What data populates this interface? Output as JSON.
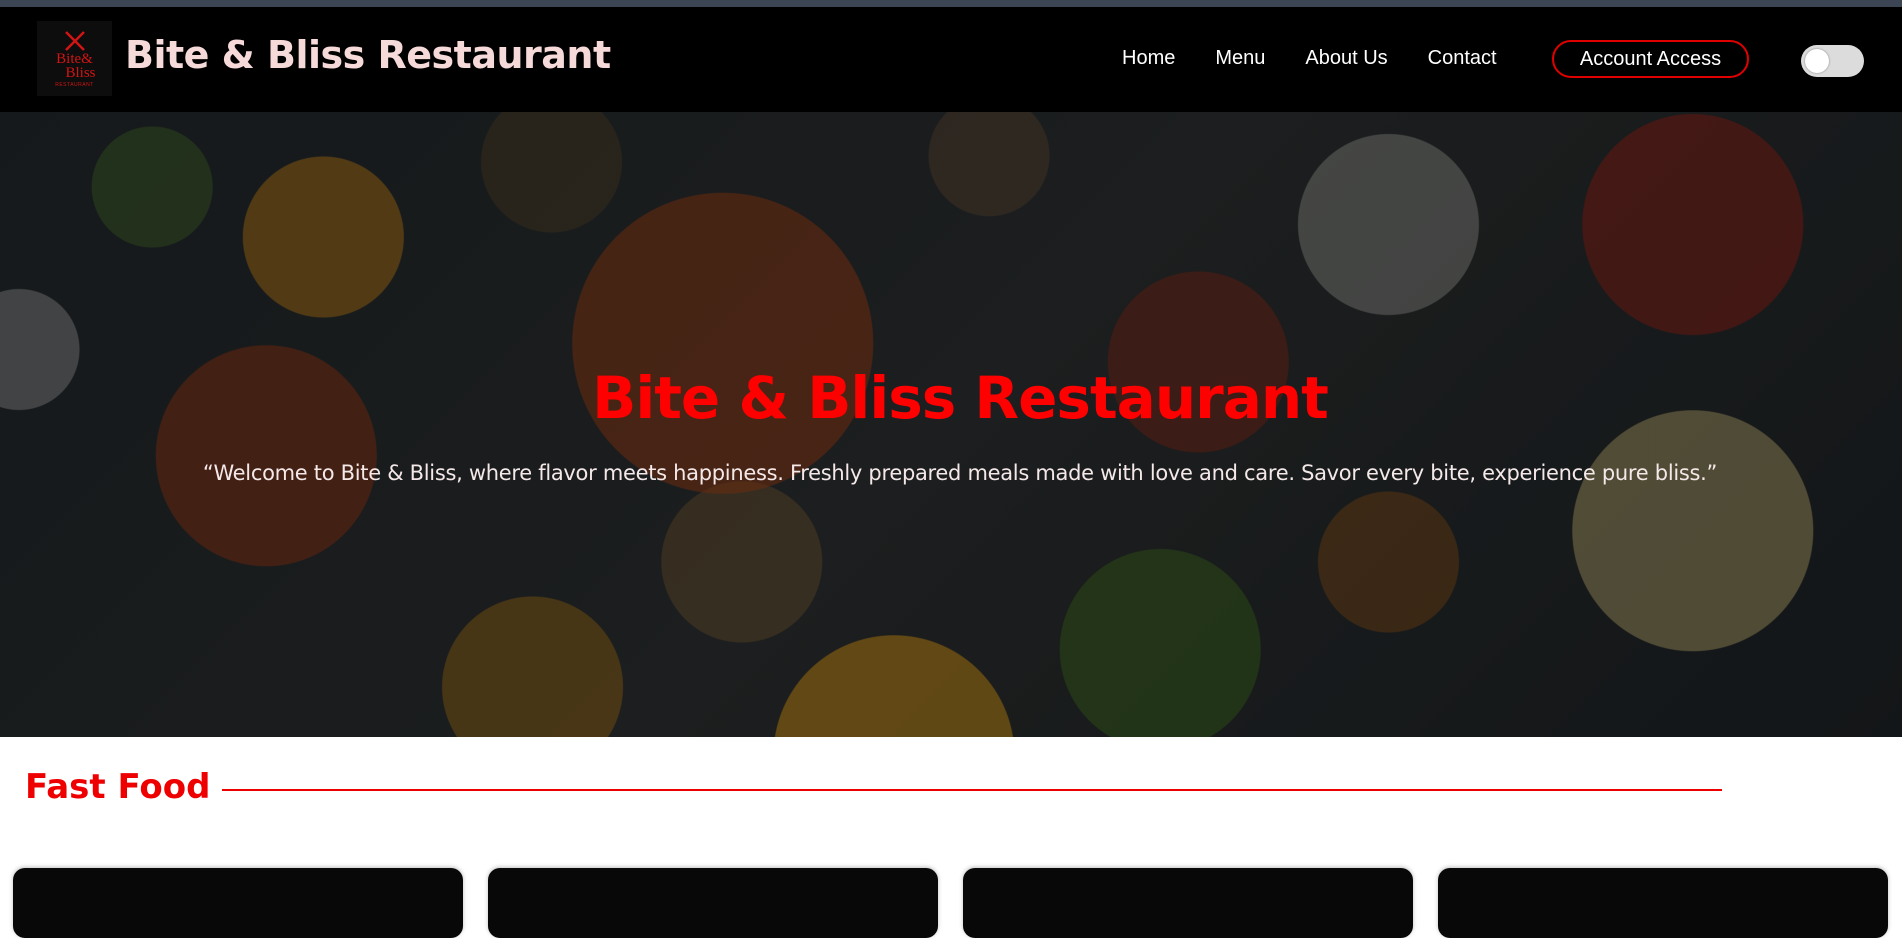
{
  "header": {
    "logo": {
      "line1": "Bite&",
      "line2": "Bliss",
      "sub": "RESTAURANT",
      "icon": "crossed-utensils-icon"
    },
    "brand": "Bite & Bliss Restaurant",
    "nav": [
      "Home",
      "Menu",
      "About Us",
      "Contact"
    ],
    "account_button": "Account Access",
    "theme_toggle": "off"
  },
  "hero": {
    "title": "Bite & Bliss Restaurant",
    "tagline": "“Welcome to Bite & Bliss, where flavor meets happiness. Freshly prepared meals made with love and care. Savor every bite, experience pure bliss.”"
  },
  "section": {
    "title": "Fast Food"
  },
  "colors": {
    "accent": "#ff0000",
    "navbar": "#000000",
    "brand_text": "#f6d9d9"
  }
}
